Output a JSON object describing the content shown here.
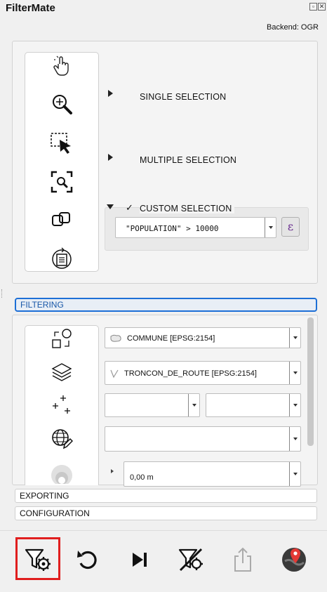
{
  "app": {
    "title": "FilterMate",
    "backend": "Backend: OGR"
  },
  "window_buttons": [
    "float-icon",
    "close-icon"
  ],
  "selection": {
    "tools": [
      "pointer-hand-icon",
      "zoom-to-icon",
      "select-rectangle-icon",
      "zoom-selection-icon",
      "identify-copy-icon",
      "refresh-layer-icon"
    ],
    "single_label": "SINGLE SELECTION",
    "multiple_label": "MULTIPLE SELECTION",
    "custom_check": "✓",
    "custom_label": "CUSTOM SELECTION",
    "expression": "\"POPULATION\" > 10000",
    "expression_button": "ε"
  },
  "filtering": {
    "header": "FILTERING",
    "source_layer": "COMMUNE [EPSG:2154]",
    "target_layer": "TRONCON_DE_ROUTE [EPSG:2154]",
    "predicate_left": "",
    "predicate_right": "",
    "geometry_field": "",
    "buffer_value": "0,00 m",
    "icons": [
      "predicate-shapes-icon",
      "layers-stack-icon",
      "crosshair-plus-icon",
      "globe-pencil-icon",
      "buffer-circle-icon"
    ]
  },
  "sections": {
    "exporting": "EXPORTING",
    "configuration": "CONFIGURATION"
  },
  "toolbar": {
    "buttons": [
      "filter-settings-icon",
      "undo-icon",
      "skip-next-icon",
      "clear-filter-icon",
      "export-icon",
      "map-pin-icon"
    ]
  },
  "colors": {
    "accent_blue": "#1d6fd6",
    "highlight_red": "#e01e1e",
    "expression_purple": "#6a2d8f"
  }
}
